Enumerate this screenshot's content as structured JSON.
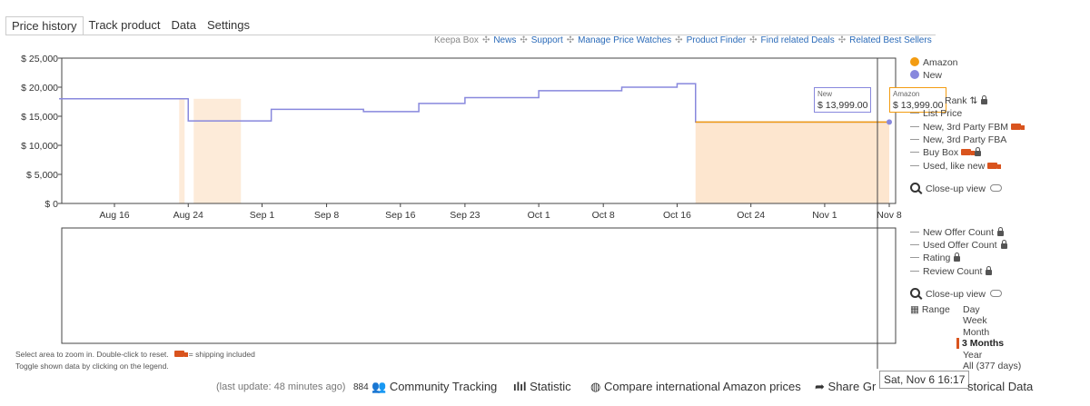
{
  "tabs": [
    "Price history",
    "Track product",
    "Data",
    "Settings"
  ],
  "top_links": {
    "keepa_box": "Keepa Box",
    "items": [
      "News",
      "Support",
      "Manage Price Watches",
      "Product Finder",
      "Find related Deals",
      "Related Best Sellers"
    ]
  },
  "legend": {
    "amazon": "Amazon",
    "new": "New",
    "sales_rank": "Rank",
    "list_price": "List Price",
    "new_fbm": "New, 3rd Party FBM",
    "new_fba": "New, 3rd Party FBA",
    "buy_box": "Buy Box",
    "used_like_new": "Used, like new",
    "closeup": "Close-up view",
    "new_offer_count": "New Offer Count",
    "used_offer_count": "Used Offer Count",
    "rating": "Rating",
    "review_count": "Review Count",
    "closeup2": "Close-up view",
    "range_label": "Range",
    "ranges": [
      "Day",
      "Week",
      "Month",
      "3 Months",
      "Year",
      "All (377 days)"
    ],
    "selected_range": "3 Months"
  },
  "colors": {
    "amazon": "#f39c12",
    "new": "#8888dd",
    "amazon_fill": "#fde6cf",
    "selected_range": "#d9541e"
  },
  "tooltips": {
    "new_label": "New",
    "new_value": "$ 13,999.00",
    "amazon_label": "Amazon",
    "amazon_value": "$ 13,999.00",
    "date": "Sat, Nov 6 16:17"
  },
  "notes": {
    "line1": "Select area to zoom in. Double-click to reset.",
    "shipping": "= shipping included",
    "line2": "Toggle shown data by clicking on the legend."
  },
  "footer": {
    "last_update": "(last update: 48 minutes ago)",
    "tracking_count": "884",
    "community": "Community Tracking",
    "statistic": "Statistic",
    "compare": "Compare international Amazon prices",
    "share": "Share Gr",
    "historical": "storical Data"
  },
  "chart_data": {
    "type": "line",
    "y_ticks": [
      "$ 25,000",
      "$ 20,000",
      "$ 15,000",
      "$ 10,000",
      "$ 5,000",
      "$ 0"
    ],
    "x_ticks": [
      "Aug 16",
      "Aug 24",
      "Sep 1",
      "Sep 8",
      "Sep 16",
      "Sep 23",
      "Oct 1",
      "Oct 8",
      "Oct 16",
      "Oct 24",
      "Nov 1",
      "Nov 8"
    ],
    "ylim": [
      0,
      25000
    ],
    "series": [
      {
        "name": "New",
        "points": [
          [
            "Aug 10",
            18000
          ],
          [
            "Aug 24",
            18100
          ],
          [
            "Aug 24",
            14200
          ],
          [
            "Sep 2",
            16200
          ],
          [
            "Sep 12",
            15800
          ],
          [
            "Sep 18",
            17200
          ],
          [
            "Sep 23",
            18200
          ],
          [
            "Oct 1",
            19400
          ],
          [
            "Oct 10",
            20000
          ],
          [
            "Oct 16",
            20600
          ],
          [
            "Oct 18",
            14000
          ],
          [
            "Nov 6",
            14000
          ],
          [
            "Nov 8",
            13999
          ]
        ]
      },
      {
        "name": "Amazon",
        "points": [
          [
            "Oct 18",
            14000
          ],
          [
            "Nov 8",
            13999
          ]
        ]
      }
    ]
  }
}
